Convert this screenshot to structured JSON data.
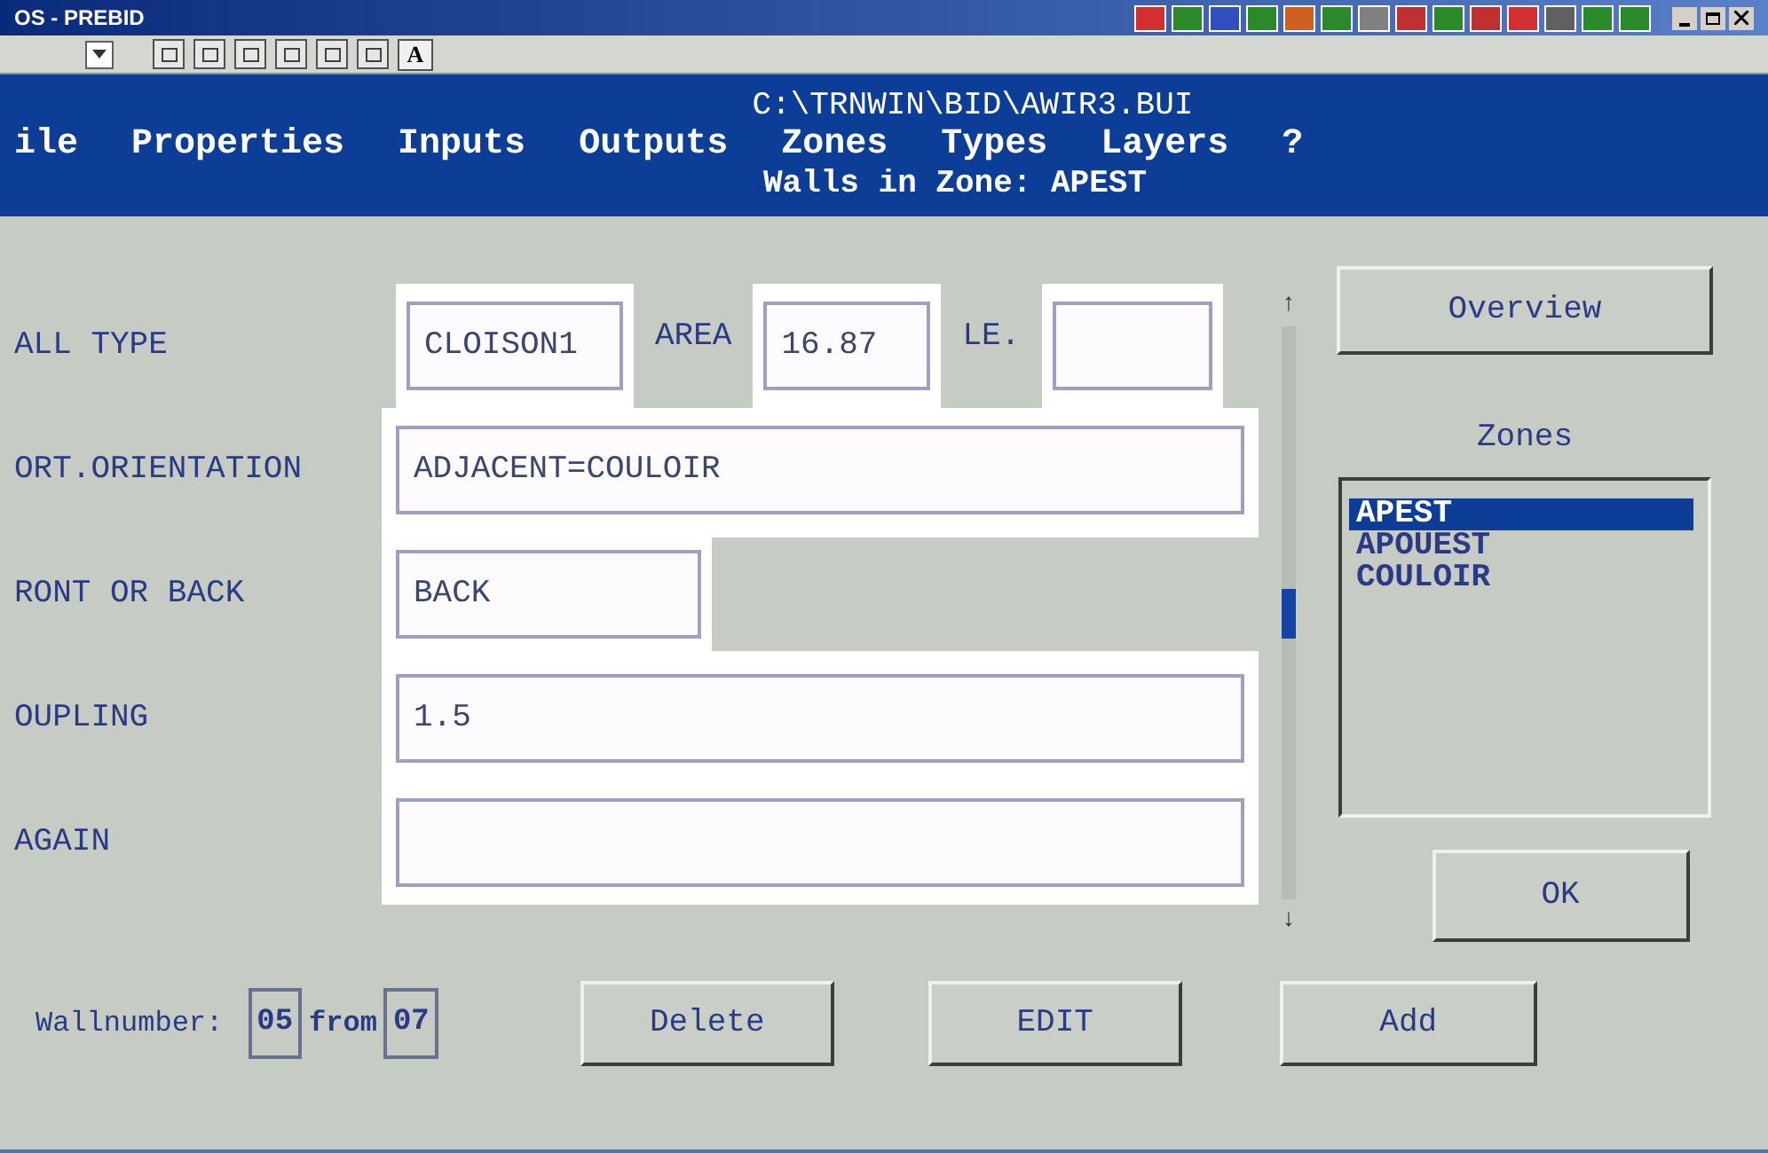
{
  "title_bar": {
    "title": "OS - PREBID"
  },
  "toolbar": {
    "font_button": "A"
  },
  "header": {
    "path": "C:\\TRNWIN\\BID\\AWIR3.BUI",
    "menu": [
      "ile",
      "Properties",
      "Inputs",
      "Outputs",
      "Zones",
      "Types",
      "Layers",
      "?"
    ],
    "subtitle": "Walls in Zone: APEST"
  },
  "form": {
    "rows": [
      {
        "label": "ALL TYPE",
        "kind": "split",
        "parts": [
          {
            "value": "CLOISON1"
          },
          {
            "label": "AREA",
            "value": "16.87"
          },
          {
            "label": "LE."
          }
        ]
      },
      {
        "label": "ORT.ORIENTATION",
        "kind": "wide",
        "value": "ADJACENT=COULOIR"
      },
      {
        "label": "RONT OR BACK",
        "kind": "short",
        "value": "BACK"
      },
      {
        "label": "OUPLING",
        "kind": "wide",
        "value": "1.5"
      },
      {
        "label": "AGAIN",
        "kind": "wide"
      }
    ]
  },
  "scrollbar": {
    "up": "↑",
    "down": "↓"
  },
  "overview_button": "Overview",
  "zones": {
    "label": "Zones",
    "items": [
      {
        "text": "APEST",
        "selected": true
      },
      {
        "text": "APOUEST",
        "selected": false
      },
      {
        "text": "COULOIR",
        "selected": false
      }
    ]
  },
  "ok_button": "OK",
  "wallnumber": {
    "label": "Wallnumber:",
    "current": "05",
    "word": "from",
    "total": "07"
  },
  "buttons": [
    "Delete",
    "EDIT",
    "Add"
  ]
}
